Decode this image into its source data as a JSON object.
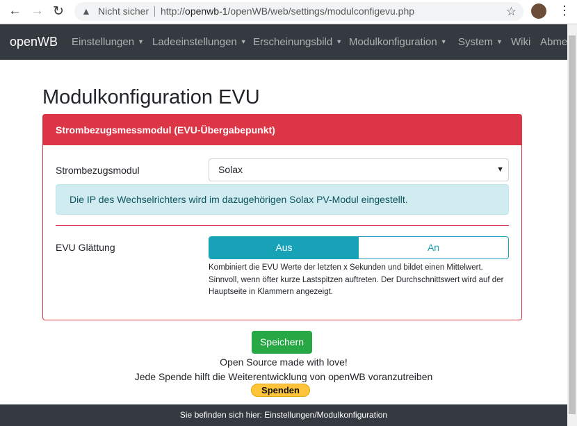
{
  "browser": {
    "warning": "Nicht sicher",
    "url_prefix": "http://",
    "url_host": "openwb-1",
    "url_path": "/openWB/web/settings/modulconfigevu.php"
  },
  "navbar": {
    "brand": "openWB",
    "items": [
      "Einstellungen",
      "Ladeeinstellungen",
      "Erscheinungsbild",
      "Modulkonfiguration",
      "System",
      "Wiki",
      "Abmelden"
    ]
  },
  "page": {
    "title": "Modulkonfiguration EVU"
  },
  "card": {
    "header": "Strombezugsmessmodul (EVU-Übergabepunkt)",
    "module_label": "Strombezugsmodul",
    "module_value": "Solax",
    "info": "Die IP des Wechselrichters wird im dazugehörigen Solax PV-Modul eingestellt.",
    "smoothing_label": "EVU Glättung",
    "options": [
      "Aus",
      "An"
    ],
    "selected": "Aus",
    "help": "Kombiniert die EVU Werte der letzten x Sekunden und bildet einen Mittelwert. Sinnvoll, wenn öfter kurze Lastspitzen auftreten. Der Durchschnittswert wird auf der Hauptseite in Klammern angezeigt."
  },
  "save_label": "Speichern",
  "footer_text": {
    "love": "Open Source made with love!",
    "donate_text": "Jede Spende hilft die Weiterentwicklung von openWB voranzutreiben",
    "donate_button": "Spenden"
  },
  "breadcrumb": "Sie befinden sich hier: Einstellungen/Modulkonfiguration"
}
